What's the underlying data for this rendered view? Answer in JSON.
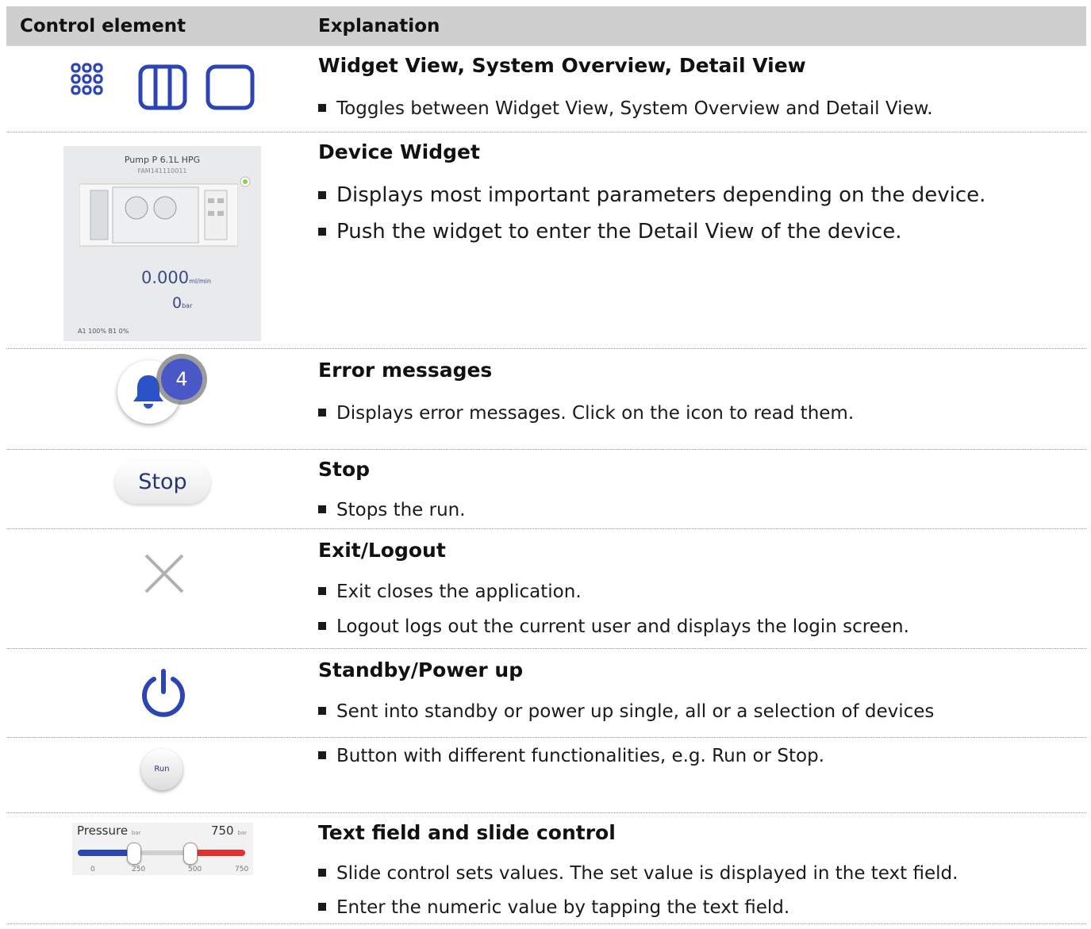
{
  "header": {
    "col1": "Control element",
    "col2": "Explanation"
  },
  "rows": {
    "views": {
      "title": "Widget View, System Overview, Detail View",
      "bullets": [
        "Toggles between Widget View, System Overview and Detail View."
      ],
      "icons": [
        "widget-grid-icon",
        "system-overview-icon",
        "detail-view-icon"
      ]
    },
    "widget": {
      "title": "Device Widget",
      "bullets": [
        "Displays most important parameters depending on the device.",
        "Push the widget to enter the Detail View of the device."
      ],
      "image": {
        "name": "Pump P 6.1L HPG",
        "serial": "FAM141110011",
        "flow_value": "0.000",
        "flow_unit": "ml/min",
        "pressure_value": "0",
        "pressure_unit": "bar",
        "composition": "A1 100%  B1 0%"
      }
    },
    "errors": {
      "title": "Error messages",
      "bullets": [
        "Displays error messages. Click on the icon to read them."
      ],
      "badge_count": "4",
      "icon": "bell-icon"
    },
    "stop": {
      "title": "Stop",
      "bullets": [
        "Stops the run."
      ],
      "button_label": "Stop"
    },
    "exit": {
      "title": "Exit/Logout",
      "bullets": [
        "Exit closes the application.",
        "Logout logs out the current user and displays the login screen."
      ],
      "icon": "close-icon"
    },
    "standby": {
      "title": "Standby/Power up",
      "bullets": [
        "Sent into standby or power up single, all or a selection of devices"
      ],
      "icon": "power-icon"
    },
    "run": {
      "bullets": [
        "Button with different functionalities, e.g. Run or Stop."
      ],
      "button_label": "Run"
    },
    "slider": {
      "title": "Text field and slide control",
      "bullets": [
        "Slide control sets values. The set value is displayed in the text field.",
        "Enter the numeric value by tapping the text field."
      ],
      "label": "Pressure",
      "label_unit": "bar",
      "max_value": "750",
      "max_unit": "bar",
      "ticks": [
        "0",
        "250",
        "500",
        "750"
      ],
      "low_handle_fraction": 0.333,
      "high_handle_fraction": 0.667
    }
  },
  "colors": {
    "accent": "#2c44b4",
    "badge": "#4a57c6",
    "slider_high": "#e23030",
    "header_bg": "#cfcfcf"
  }
}
